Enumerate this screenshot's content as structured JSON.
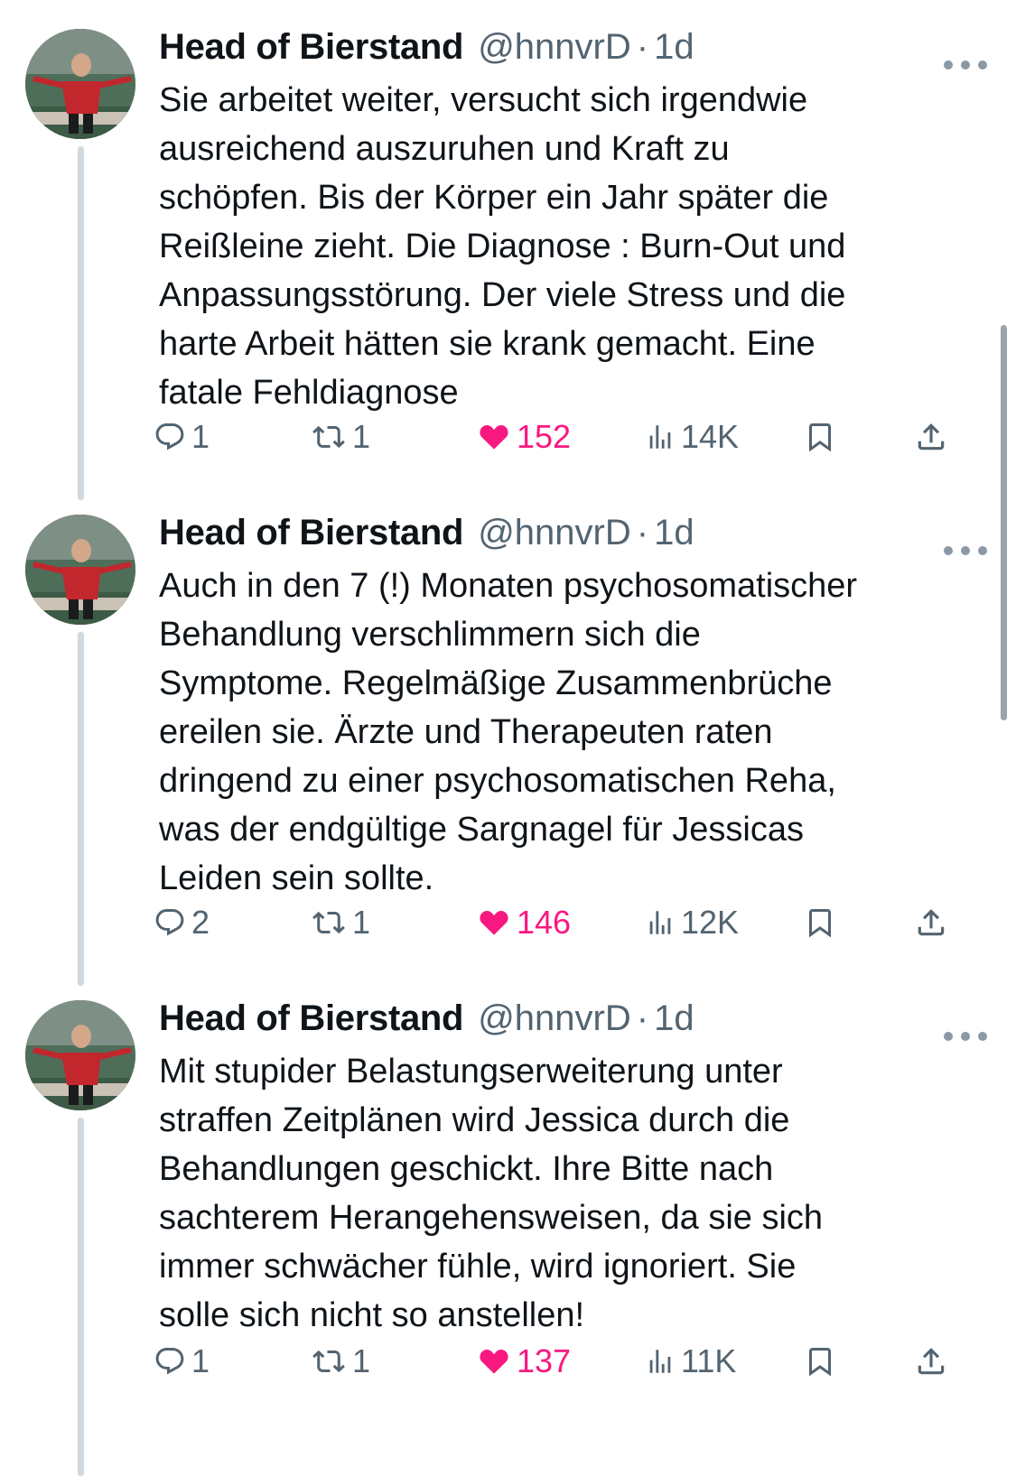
{
  "tweets": [
    {
      "name": "Head of Bierstand",
      "handle": "@hnnvrD",
      "separator": "·",
      "time": "1d",
      "text": "Sie arbeitet weiter, versucht sich irgendwie\nausreichend auszuruhen und Kraft zu\nschöpfen. Bis der Körper ein Jahr später die\nReißleine zieht. Die Diagnose : Burn-Out und\nAnpassungsstörung. Der viele Stress und die\nharte Arbeit hätten sie krank gemacht. Eine\nfatale Fehldiagnose",
      "replies": "1",
      "retweets": "1",
      "likes": "152",
      "views": "14K"
    },
    {
      "name": "Head of Bierstand",
      "handle": "@hnnvrD",
      "separator": "·",
      "time": "1d",
      "text": "Auch in den 7 (!) Monaten psychosomatischer\nBehandlung verschlimmern sich die\nSymptome. Regelmäßige Zusammenbrüche\nereilen sie. Ärzte und Therapeuten raten\ndringend zu einer psychosomatischen Reha,\nwas der endgültige Sargnagel für Jessicas\nLeiden sein sollte.",
      "replies": "2",
      "retweets": "1",
      "likes": "146",
      "views": "12K"
    },
    {
      "name": "Head of Bierstand",
      "handle": "@hnnvrD",
      "separator": "·",
      "time": "1d",
      "text": "Mit stupider Belastungserweiterung unter\nstraffen Zeitplänen wird Jessica durch die\nBehandlungen geschickt. Ihre Bitte nach\nsachterem Herangehensweisen, da sie sich\nimmer schwächer fühle, wird ignoriert. Sie\nsolle sich nicht so anstellen!",
      "replies": "1",
      "retweets": "1",
      "likes": "137",
      "views": "11K"
    }
  ],
  "icons": {
    "reply": "reply-icon",
    "retweet": "retweet-icon",
    "like": "heart-icon",
    "views": "views-icon",
    "bookmark": "bookmark-icon",
    "share": "share-icon",
    "more": "more-icon"
  },
  "colors": {
    "like": "#f91880",
    "secondary_text": "#536471",
    "thread_line": "#cfd9de"
  }
}
